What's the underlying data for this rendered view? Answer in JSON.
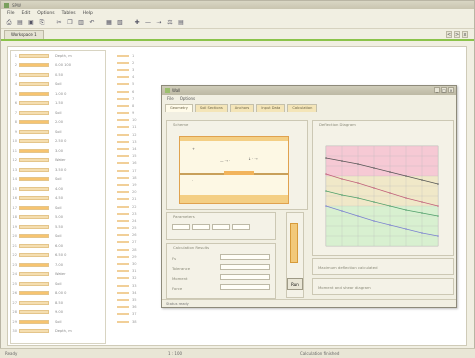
{
  "app": {
    "title": "SPW",
    "menu": [
      "File",
      "Edit",
      "Options",
      "Tables",
      "Help"
    ],
    "tab": "Workspace 1",
    "tab_controls": [
      "<",
      ">",
      "x"
    ]
  },
  "list": {
    "rows": [
      {
        "num": "1",
        "text": "Depth, m"
      },
      {
        "num": "2",
        "text": "0.00 100"
      },
      {
        "num": "3",
        "text": "0.50"
      },
      {
        "num": "4",
        "text": "Soil"
      },
      {
        "num": "5",
        "text": "1.00 0"
      },
      {
        "num": "6",
        "text": "1.50"
      },
      {
        "num": "7",
        "text": "Soil"
      },
      {
        "num": "8",
        "text": "2.00"
      },
      {
        "num": "9",
        "text": "Soil"
      },
      {
        "num": "10",
        "text": "2.50 0"
      },
      {
        "num": "11",
        "text": "3.00"
      },
      {
        "num": "12",
        "text": "Water"
      },
      {
        "num": "13",
        "text": "3.50 0"
      },
      {
        "num": "14",
        "text": "Soil"
      },
      {
        "num": "15",
        "text": "4.00"
      },
      {
        "num": "16",
        "text": "4.50"
      },
      {
        "num": "17",
        "text": "Soil"
      },
      {
        "num": "18",
        "text": "5.00"
      },
      {
        "num": "19",
        "text": "5.50"
      },
      {
        "num": "20",
        "text": "Soil"
      },
      {
        "num": "21",
        "text": "6.00"
      },
      {
        "num": "22",
        "text": "6.50 0"
      },
      {
        "num": "23",
        "text": "7.00"
      },
      {
        "num": "24",
        "text": "Water"
      },
      {
        "num": "25",
        "text": "Soil"
      },
      {
        "num": "26",
        "text": "8.00 0"
      },
      {
        "num": "27",
        "text": "8.50"
      },
      {
        "num": "28",
        "text": "9.00"
      },
      {
        "num": "29",
        "text": "Soil"
      },
      {
        "num": "30",
        "text": "Depth, m"
      }
    ]
  },
  "mid": {
    "rows": [
      "1",
      "2",
      "3",
      "4",
      "5",
      "6",
      "7",
      "8",
      "9",
      "10",
      "11",
      "12",
      "13",
      "14",
      "15",
      "16",
      "17",
      "18",
      "19",
      "20",
      "21",
      "22",
      "23",
      "24",
      "25",
      "26",
      "27",
      "28",
      "29",
      "30",
      "31",
      "32",
      "33",
      "34",
      "35",
      "36",
      "37",
      "38"
    ]
  },
  "dialog": {
    "title": "Wall",
    "menu": [
      "File",
      "Options"
    ],
    "tabs": [
      "Geometry",
      "Soil Sections",
      "Anchors",
      "Input Data",
      "Calculation"
    ],
    "scheme_label": "Scheme",
    "chart_label": "Deflection Diagram",
    "params_label": "Parameters",
    "result_label": "Calculation Results",
    "result_rows": [
      "Fs",
      "Tolerance",
      "Moment",
      "Force"
    ],
    "result_values": [
      "",
      "",
      "",
      ""
    ],
    "run_button": "Run",
    "summary_1": "Maximum deflection calculated",
    "summary_2": "Moment and shear diagram",
    "status": "Status ready"
  },
  "chart_data": {
    "type": "line",
    "title": "",
    "xlabel": "",
    "ylabel": "",
    "x": [
      0,
      1,
      2,
      3,
      4,
      5,
      6,
      7
    ],
    "xlim": [
      0,
      7
    ],
    "ylim": [
      0,
      100
    ],
    "bands": [
      {
        "from": 70,
        "to": 100,
        "color": "#f6c9d4"
      },
      {
        "from": 40,
        "to": 70,
        "color": "#f0e8c8"
      },
      {
        "from": 0,
        "to": 40,
        "color": "#d8f0d0"
      }
    ],
    "series": [
      {
        "values": [
          88,
          85,
          82,
          78,
          74,
          70,
          66,
          62
        ],
        "color": "#555555"
      },
      {
        "values": [
          72,
          67,
          63,
          58,
          53,
          48,
          44,
          40
        ],
        "color": "#c0607a"
      },
      {
        "values": [
          55,
          51,
          48,
          44,
          40,
          36,
          33,
          30
        ],
        "color": "#4f9f6a"
      },
      {
        "values": [
          40,
          35,
          30,
          25,
          21,
          17,
          13,
          10
        ],
        "color": "#7a7fd0"
      }
    ]
  }
}
